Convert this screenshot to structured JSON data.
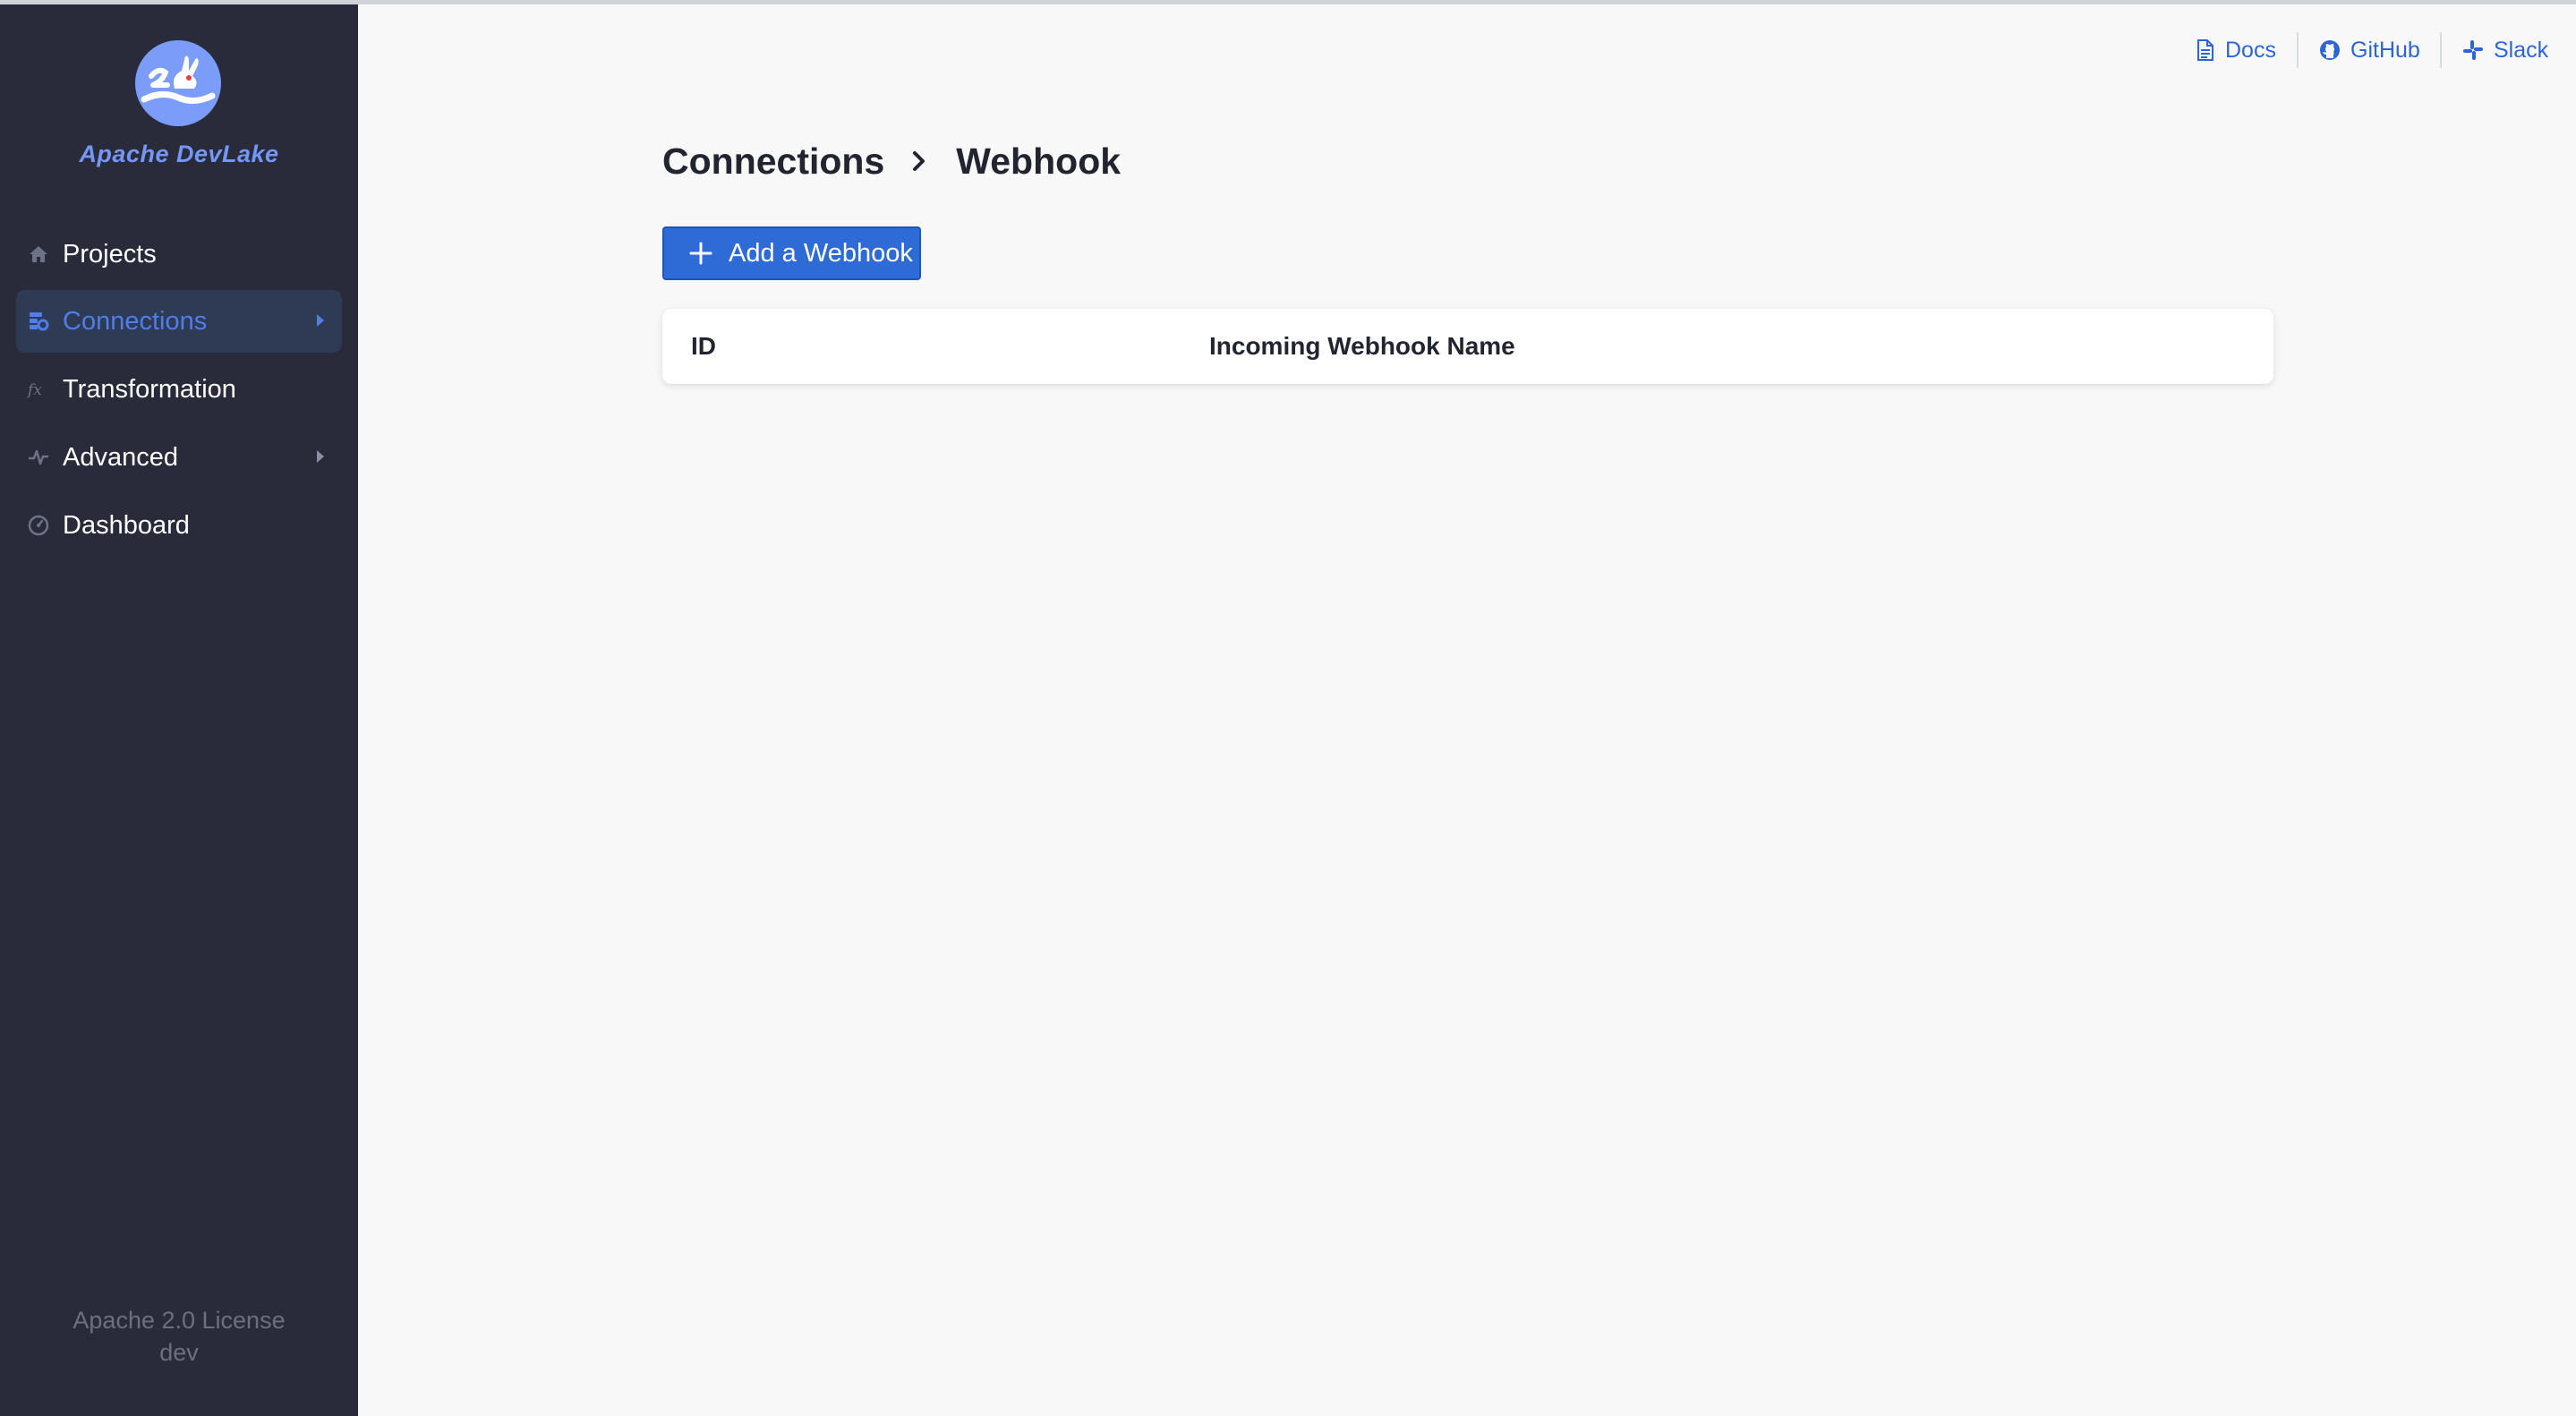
{
  "app": {
    "brand": "Apache DevLake"
  },
  "sidebar": {
    "items": [
      {
        "label": "Projects",
        "icon": "home-icon"
      },
      {
        "label": "Connections",
        "icon": "database-icon",
        "active": true,
        "has_submenu": true
      },
      {
        "label": "Transformation",
        "icon": "function-icon"
      },
      {
        "label": "Advanced",
        "icon": "pulse-icon",
        "has_submenu": true
      },
      {
        "label": "Dashboard",
        "icon": "dashboard-icon"
      }
    ],
    "footer": {
      "license": "Apache 2.0 License",
      "version": "dev"
    }
  },
  "topnav": {
    "docs": "Docs",
    "github": "GitHub",
    "slack": "Slack"
  },
  "breadcrumb": {
    "parent": "Connections",
    "current": "Webhook"
  },
  "toolbar": {
    "add_label": "Add a Webhook"
  },
  "table": {
    "columns": [
      "ID",
      "Incoming Webhook Name"
    ],
    "rows": []
  },
  "colors": {
    "sidebar_bg": "#292b3a",
    "accent": "#2f6bd6",
    "brand": "#7497f7",
    "page_bg": "#f8f8f8"
  }
}
